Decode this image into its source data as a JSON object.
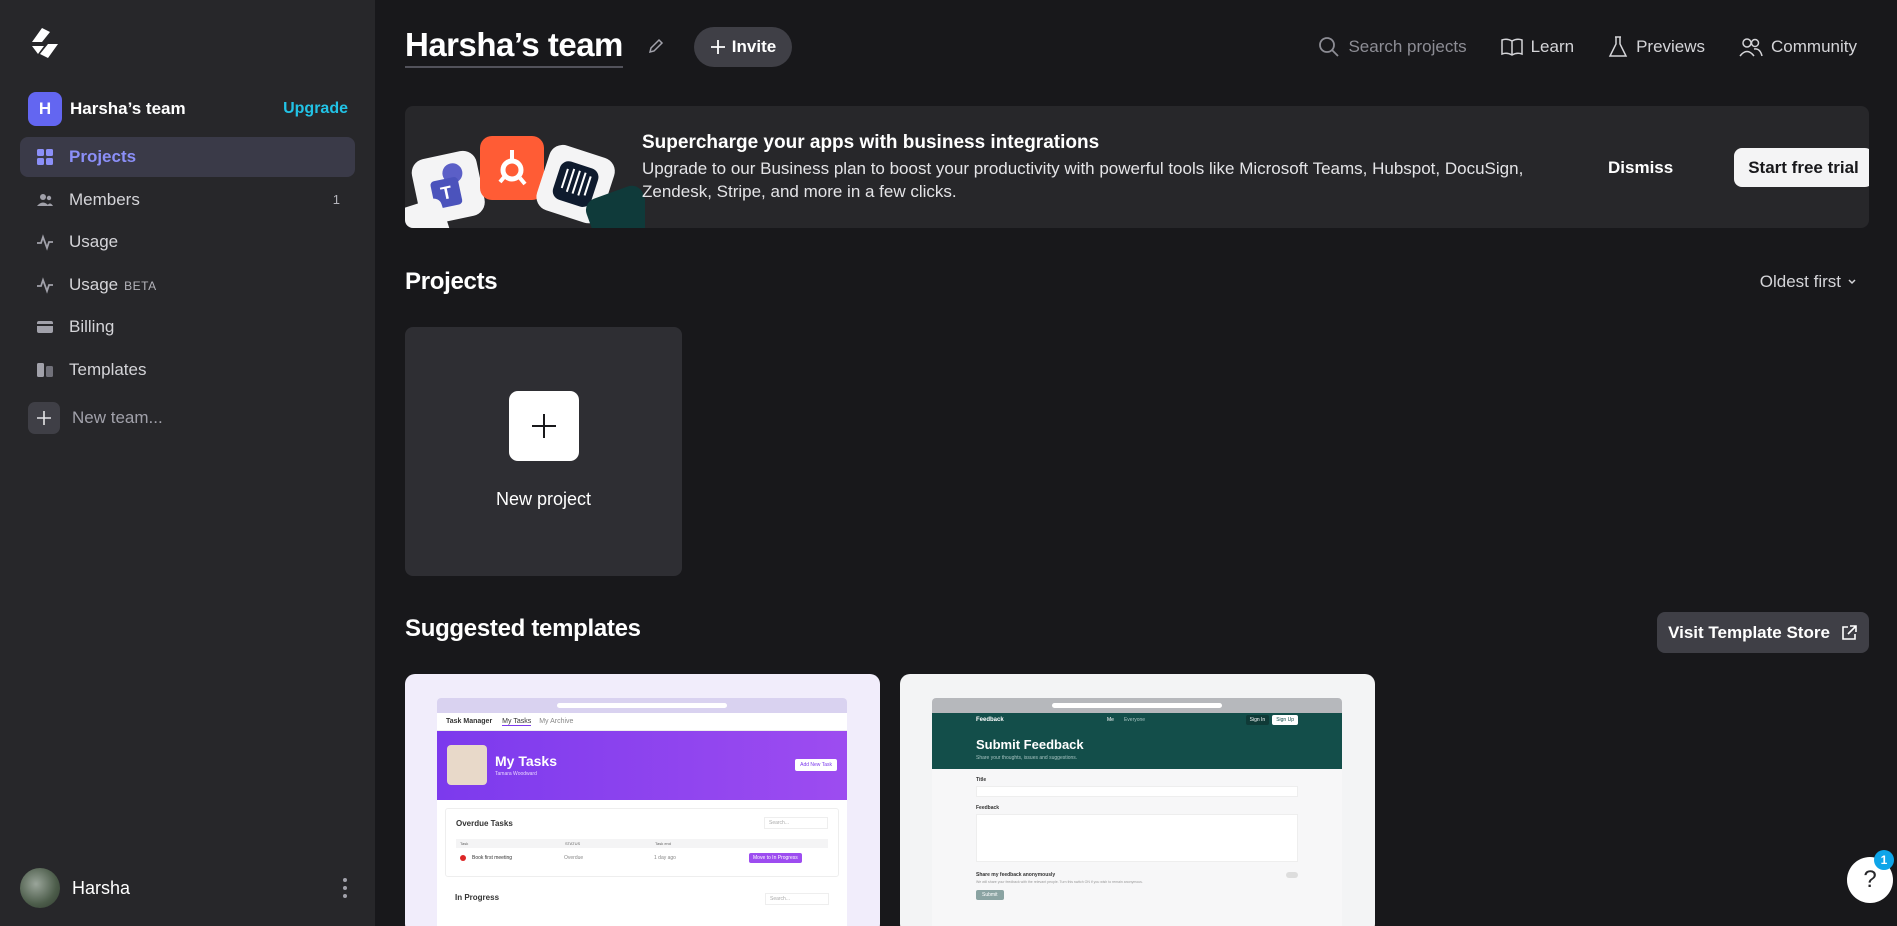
{
  "sidebar": {
    "team_initial": "H",
    "team_name": "Harsha’s team",
    "upgrade_label": "Upgrade",
    "items": [
      {
        "label": "Projects",
        "icon": "grid-icon",
        "active": true
      },
      {
        "label": "Members",
        "icon": "users-icon",
        "count": "1"
      },
      {
        "label": "Usage",
        "icon": "activity-icon"
      },
      {
        "label": "Usage",
        "icon": "activity-icon",
        "badge": "BETA"
      },
      {
        "label": "Billing",
        "icon": "card-icon"
      },
      {
        "label": "Templates",
        "icon": "templates-icon"
      }
    ],
    "new_team_label": "New team...",
    "user_name": "Harsha"
  },
  "header": {
    "title": "Harsha’s team",
    "invite_label": "Invite",
    "search_placeholder": "Search projects",
    "learn_label": "Learn",
    "previews_label": "Previews",
    "community_label": "Community"
  },
  "banner": {
    "title": "Supercharge your apps with business integrations",
    "description": "Upgrade to our Business plan to boost your productivity with powerful tools like Microsoft Teams, Hubspot, DocuSign, Zendesk, Stripe, and more in a few clicks.",
    "dismiss_label": "Dismiss",
    "cta_label": "Start free trial"
  },
  "projects": {
    "heading": "Projects",
    "sort_label": "Oldest first",
    "new_project_label": "New project"
  },
  "templates": {
    "heading": "Suggested templates",
    "visit_label": "Visit Template Store",
    "cards": [
      {
        "app_title": "Task Manager",
        "tab_1": "My Tasks",
        "tab_2": "My Archive",
        "hero_title": "My Tasks",
        "hero_sub": "Tamara Woodward",
        "hero_button": "Add New Task",
        "section_1": "Overdue Tasks",
        "search": "Search...",
        "col_1": "Task",
        "col_2": "STATUS",
        "col_3": "Task end",
        "row_task": "Book first meeting",
        "row_status": "Overdue",
        "row_due": "1 day ago",
        "row_action": "Move to In Progress",
        "section_2": "In Progress"
      },
      {
        "app_title": "Feedback",
        "nav_1": "Me",
        "nav_2": "Everyone",
        "sign_in": "Sign In",
        "sign_up": "Sign Up",
        "hero_title": "Submit Feedback",
        "hero_sub": "Share your thoughts, issues and suggestions.",
        "field_1": "Title",
        "field_2": "Feedback",
        "anon_label": "Share my feedback anonymously",
        "anon_help": "We will share your feedback with the relevant people. Turn this switch ON if you wish to remain anonymous.",
        "submit": "Submit"
      }
    ]
  },
  "help": {
    "label": "?",
    "badge": "1"
  },
  "colors": {
    "accent": "#8b8ff8",
    "upgrade": "#22c3e6",
    "sidebar_bg": "#27272a",
    "page_bg": "#18181b"
  }
}
